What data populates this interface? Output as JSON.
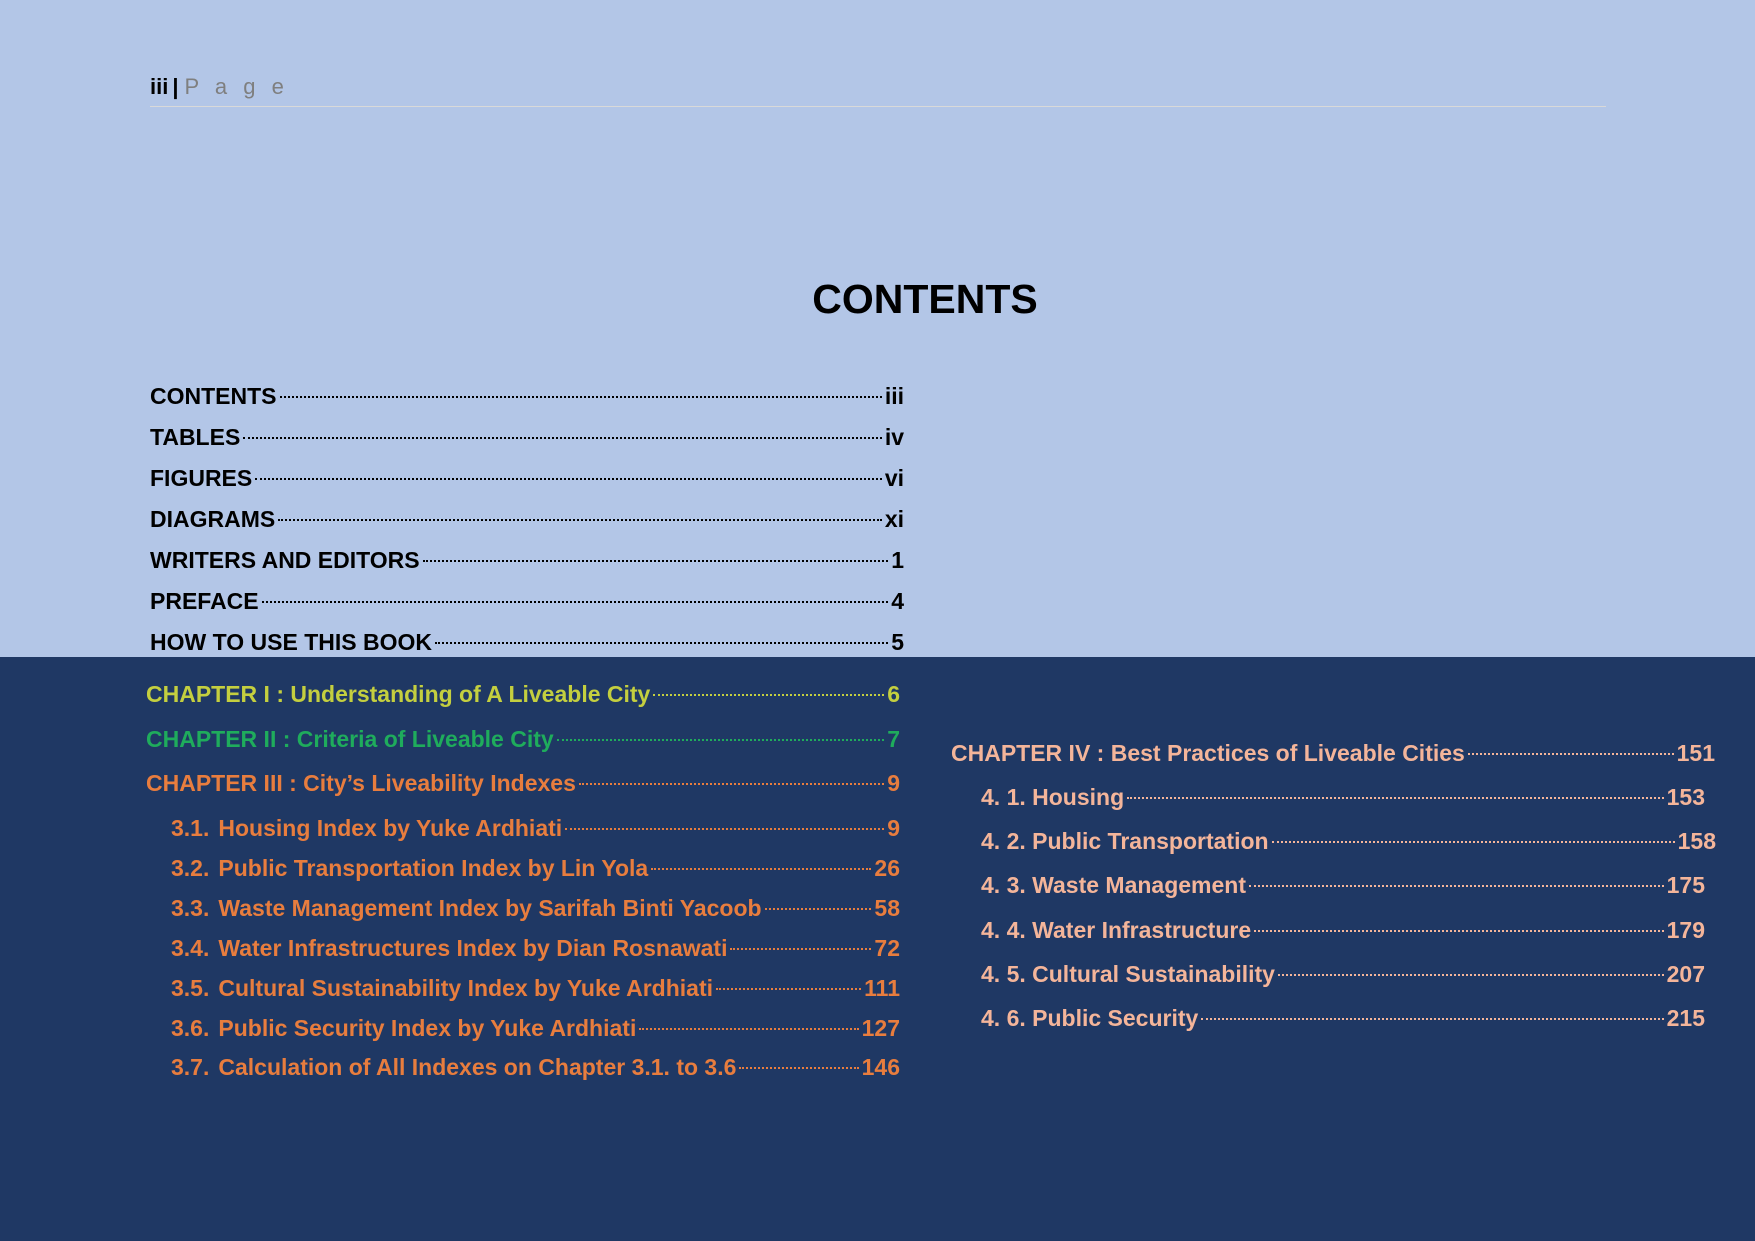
{
  "header": {
    "page_number": "iii",
    "separator": "|",
    "page_word": "P a g e"
  },
  "title": "CONTENTS",
  "front_matter": [
    {
      "label": "CONTENTS",
      "page": "iii"
    },
    {
      "label": "TABLES",
      "page": "iv"
    },
    {
      "label": "FIGURES",
      "page": "vi"
    },
    {
      "label": "DIAGRAMS",
      "page": "xi"
    },
    {
      "label": "WRITERS AND EDITORS",
      "page": "1"
    },
    {
      "label": "PREFACE",
      "page": "4"
    },
    {
      "label": "HOW TO USE THIS BOOK",
      "page": "5"
    }
  ],
  "chapters_left": [
    {
      "label": "CHAPTER I : Understanding of A Liveable City",
      "page": "6"
    },
    {
      "label": "CHAPTER II : Criteria of Liveable City",
      "page": "7"
    },
    {
      "label": "CHAPTER III : City’s Liveability Indexes",
      "page": "9"
    }
  ],
  "chapter3_sections": [
    {
      "index": "3.1.",
      "label": "Housing Index by Yuke Ardhiati",
      "page": "9"
    },
    {
      "index": "3.2.",
      "label": "Public Transportation Index by Lin Yola",
      "page": "26"
    },
    {
      "index": "3.3.",
      "label": "Waste Management Index by Sarifah Binti Yacoob",
      "page": "58"
    },
    {
      "index": "3.4.",
      "label": "Water Infrastructures Index by Dian Rosnawati",
      "page": "72"
    },
    {
      "index": "3.5.",
      "label": "Cultural Sustainability Index by Yuke Ardhiati",
      "page": "111"
    },
    {
      "index": "3.6.",
      "label": "Public Security Index by Yuke Ardhiati",
      "page": "127"
    },
    {
      "index": "3.7.",
      "label": "Calculation of All Indexes on Chapter 3.1. to 3.6",
      "page": "146"
    }
  ],
  "chapter4": {
    "label": "CHAPTER IV : Best Practices of Liveable Cities",
    "page": "151"
  },
  "chapter4_sections": [
    {
      "label": "4. 1. Housing",
      "page": "153"
    },
    {
      "label": "4. 2. Public Transportation",
      "page": "158"
    },
    {
      "label": "4. 3. Waste Management",
      "page": "175"
    },
    {
      "label": "4. 4. Water Infrastructure",
      "page": "179"
    },
    {
      "label": "4. 5. Cultural Sustainability",
      "page": "207"
    },
    {
      "label": "4. 6. Public Security",
      "page": "215"
    }
  ],
  "colors": {
    "top_background": "#b3c6e7",
    "bottom_background": "#1f3864",
    "chapter1": "#c4cf3f",
    "chapter2": "#1fac5c",
    "chapter3": "#e87d3e",
    "chapter4": "#f4b59a"
  }
}
